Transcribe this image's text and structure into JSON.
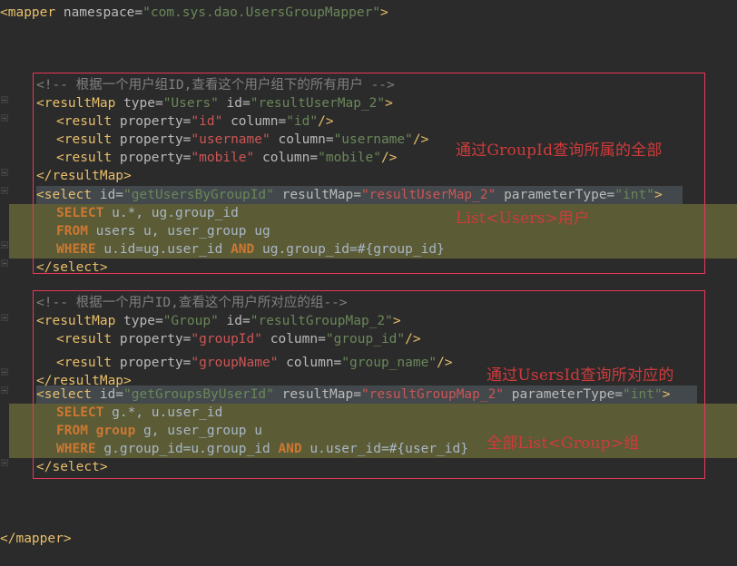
{
  "editor": {
    "background": "#2b2b2b",
    "default_text_color": "#a9b7c6",
    "sql_highlight_color": "#5b5b36",
    "selection_color": "#42484b",
    "annotation_color": "#cf3b3b",
    "annotation_border_color": "#e8365a"
  },
  "code": {
    "mapper_open": {
      "tag_open": "<mapper",
      "attr_namespace": " namespace=",
      "value_namespace": "\"com.sys.dao.UsersGroupMapper\"",
      "tag_close": ">"
    },
    "mapper_close": "</mapper>",
    "block1": {
      "comment": "<!-- 根据一个用户组ID,查看这个用户组下的所有用户 -->",
      "resultmap_open": {
        "tag": "<resultMap",
        "attr_type": " type=",
        "value_type": "\"Users\"",
        "attr_id": " id=",
        "value_id": "\"resultUserMap_2\"",
        "close": ">"
      },
      "results": [
        {
          "tag": "<result",
          "attr_property": " property=",
          "value_property": "\"id\"",
          "attr_column": " column=",
          "value_column": "\"id\"",
          "close": "/>"
        },
        {
          "tag": "<result",
          "attr_property": " property=",
          "value_property": "\"username\"",
          "attr_column": " column=",
          "value_column": "\"username\"",
          "close": "/>"
        },
        {
          "tag": "<result",
          "attr_property": " property=",
          "value_property": "\"mobile\"",
          "attr_column": " column=",
          "value_column": "\"mobile\"",
          "close": "/>"
        }
      ],
      "resultmap_close": "</resultMap>",
      "select_open": {
        "tag": "<select",
        "attr_id": " id=",
        "value_id": "\"getUsersByGroupId\"",
        "attr_resultmap": " resultMap=",
        "value_resultmap": "\"resultUserMap_2\"",
        "attr_paramtype": " parameterType=",
        "value_paramtype": "\"int\"",
        "close": ">"
      },
      "sql": [
        {
          "kw": "SELECT",
          "rest": " u.*, ug.group_id"
        },
        {
          "kw": "FROM",
          "rest": " users u, user_group ug"
        },
        {
          "kw": "WHERE",
          "rest": " u.id=ug.user_id ",
          "kw2": "AND",
          "rest2": " ug.group_id=#{group_id}"
        }
      ],
      "select_close": "</select>",
      "annotation_line1": "通过GroupId查询所属的全部",
      "annotation_line2": "List<Users>用户"
    },
    "block2": {
      "comment": "<!-- 根据一个用户ID,查看这个用户所对应的组-->",
      "resultmap_open": {
        "tag": "<resultMap",
        "attr_type": " type=",
        "value_type": "\"Group\"",
        "attr_id": " id=",
        "value_id": "\"resultGroupMap_2\"",
        "close": ">"
      },
      "results": [
        {
          "tag": "<result",
          "attr_property": " property=",
          "value_property": "\"groupId\"",
          "attr_column": " column=",
          "value_column": "\"group_id\"",
          "close": "/>"
        },
        {
          "tag": "<result",
          "attr_property": " property=",
          "value_property": "\"groupName\"",
          "attr_column": " column=",
          "value_column": "\"group_name\"",
          "close": "/>"
        }
      ],
      "resultmap_close": "</resultMap>",
      "select_open": {
        "tag": "<select",
        "attr_id": " id=",
        "value_id": "\"getGroupsByUserId\"",
        "attr_resultmap": " resultMap=",
        "value_resultmap": "\"resultGroupMap_2\"",
        "attr_paramtype": " parameterType=",
        "value_paramtype": "\"int\"",
        "close": ">"
      },
      "sql": [
        {
          "kw": "SELECT",
          "rest": " g.*, u.user_id"
        },
        {
          "kw": "FROM",
          "kw_table": " group",
          "rest": " g, user_group u"
        },
        {
          "kw": "WHERE",
          "rest": " g.group_id=u.group_id ",
          "kw2": "AND",
          "rest2": " u.user_id=#{user_id}"
        }
      ],
      "select_close": "</select>",
      "annotation_line1": "通过UsersId查询所对应的",
      "annotation_line2": "全部List<Group>组"
    }
  }
}
